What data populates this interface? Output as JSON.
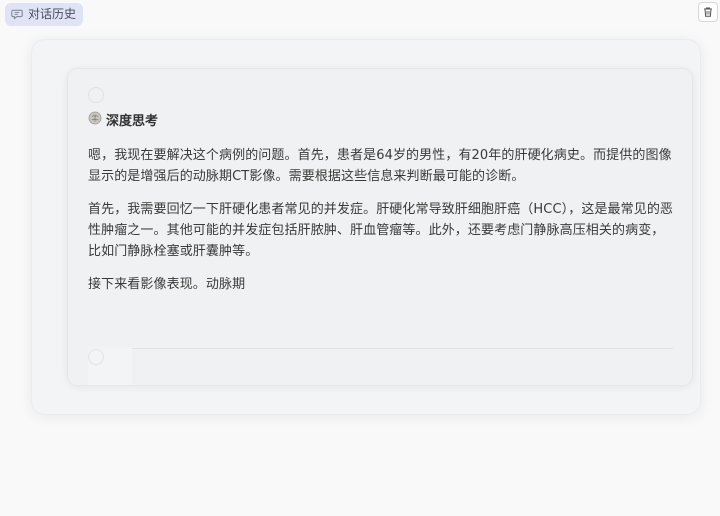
{
  "topbar": {
    "history_label": "对话历史",
    "history_icon": "chat-bubble-icon",
    "delete_icon": "trash-icon"
  },
  "thinking": {
    "title": "深度思考",
    "icon": "brain-icon",
    "paragraphs": [
      "嗯，我现在要解决这个病例的问题。首先，患者是64岁的男性，有20年的肝硬化病史。而提供的图像显示的是增强后的动脉期CT影像。需要根据这些信息来判断最可能的诊断。",
      "首先，我需要回忆一下肝硬化患者常见的并发症。肝硬化常导致肝细胞肝癌（HCC），这是最常见的恶性肿瘤之一。其他可能的并发症包括肝脓肿、肝血管瘤等。此外，还要考虑门静脉高压相关的病变，比如门静脉栓塞或肝囊肿等。",
      "接下来看影像表现。动脉期"
    ]
  },
  "colors": {
    "history_bg": "#dfe3f5",
    "card_bg": "#f0f1f2",
    "page_bg": "#f9f9fa"
  }
}
